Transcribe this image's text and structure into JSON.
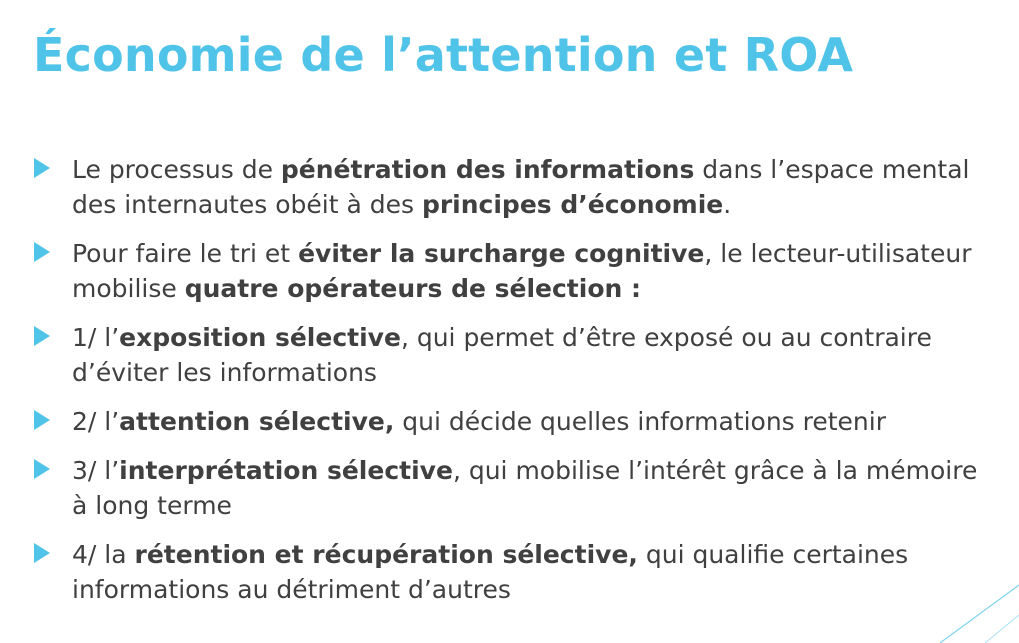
{
  "slide": {
    "title": "Économie de l’attention et ROA",
    "accent_color": "#4fc3e8",
    "text_color": "#404040",
    "bullet_icon": "triangle-right-icon"
  },
  "bullets": [
    [
      {
        "t": "Le processus de ",
        "b": false
      },
      {
        "t": "pénétration des informations",
        "b": true
      },
      {
        "t": " dans l’espace mental des internautes obéit à des ",
        "b": false
      },
      {
        "t": "principes d’économie",
        "b": true
      },
      {
        "t": ".",
        "b": false
      }
    ],
    [
      {
        "t": " Pour faire le tri et ",
        "b": false
      },
      {
        "t": "éviter la surcharge cognitive",
        "b": true
      },
      {
        "t": ", le lecteur-utilisateur mobilise ",
        "b": false
      },
      {
        "t": "quatre opérateurs de sélection :",
        "b": true
      }
    ],
    [
      {
        "t": "1/ l’",
        "b": false
      },
      {
        "t": "exposition sélective",
        "b": true
      },
      {
        "t": ", qui permet d’être exposé ou au contraire d’éviter les informations",
        "b": false
      }
    ],
    [
      {
        "t": "2/ l’",
        "b": false
      },
      {
        "t": "attention sélective,",
        "b": true
      },
      {
        "t": " qui décide quelles informations retenir",
        "b": false
      }
    ],
    [
      {
        "t": "3/ l’",
        "b": false
      },
      {
        "t": "interprétation sélective",
        "b": true
      },
      {
        "t": ", qui mobilise l’intérêt grâce à la mémoire à long terme",
        "b": false
      }
    ],
    [
      {
        "t": "4/ la ",
        "b": false
      },
      {
        "t": "rétention et récupération sélective,",
        "b": true
      },
      {
        "t": " qui qualifie certaines informations au détriment d’autres",
        "b": false
      }
    ]
  ]
}
